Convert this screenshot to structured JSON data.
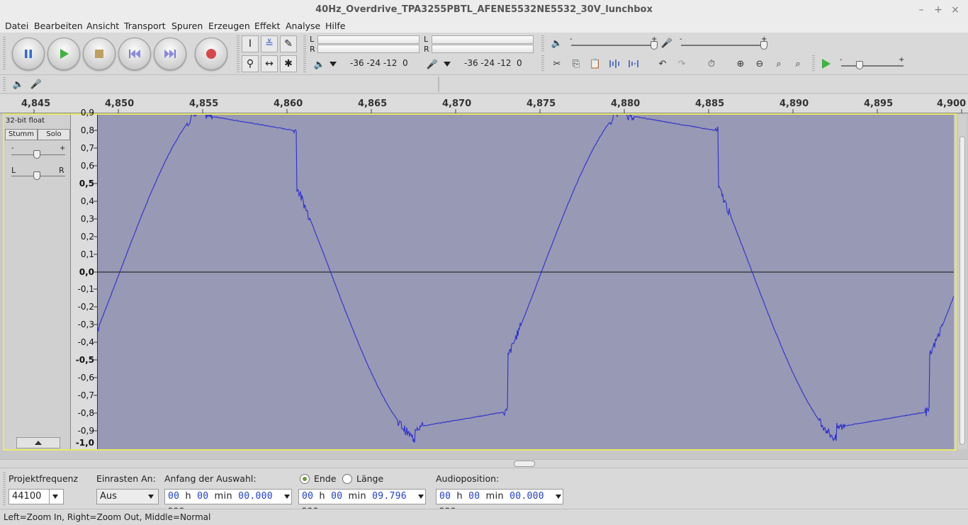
{
  "window": {
    "title": "40Hz_Overdrive_TPA3255PBTL_AFENE5532NE5532_30V_lunchbox",
    "minimize": "–",
    "maximize": "+",
    "close": "×"
  },
  "menu": [
    "Datei",
    "Bearbeiten",
    "Ansicht",
    "Transport",
    "Spuren",
    "Erzeugen",
    "Effekt",
    "Analyse",
    "Hilfe"
  ],
  "meters": {
    "play_l": "L",
    "play_r": "R",
    "rec_l": "L",
    "rec_r": "R",
    "scale_a": "-36 -24 -12  0",
    "scale_b": "-36 -24 -12  0"
  },
  "ruler": [
    "4,845",
    "4,850",
    "4,855",
    "4,860",
    "4,865",
    "4,870",
    "4,875",
    "4,880",
    "4,885",
    "4,890",
    "4,895",
    "4,900"
  ],
  "track": {
    "format": "32-bit float",
    "mute": "Stumm",
    "solo": "Solo",
    "gain_minus": "-",
    "gain_plus": "+",
    "pan_l": "L",
    "pan_r": "R"
  },
  "vruler": [
    "0,9",
    "0,8",
    "0,7",
    "0,6",
    "0,5",
    "0,4",
    "0,3",
    "0,2",
    "0,1",
    "0,0",
    "-0,1",
    "-0,2",
    "-0,3",
    "-0,4",
    "-0,5",
    "-0,6",
    "-0,7",
    "-0,8",
    "-0,9",
    "-1,0"
  ],
  "selection": {
    "rate_label": "Projektfrequenz",
    "rate_value": "44100",
    "snap_label": "Einrasten An:",
    "snap_value": "Aus",
    "start_label": "Anfang der Auswahl:",
    "end_label": "Ende",
    "length_label": "Länge",
    "audiopos_label": "Audioposition:",
    "start": {
      "h": "00",
      "m": "00",
      "s": "00.000"
    },
    "end": {
      "h": "00",
      "m": "00",
      "s": "09.796"
    },
    "pos": {
      "h": "00",
      "m": "00",
      "s": "00.000"
    },
    "unit_h": "h",
    "unit_min": "min",
    "unit_sec": "sec"
  },
  "status": "Left=Zoom In, Right=Zoom Out, Middle=Normal",
  "colors": {
    "waveform_bg": "#9899b4",
    "waveform_line": "#2b2fd0",
    "track_frame": "#e8e86a",
    "time_digits": "#1e3fd1"
  }
}
